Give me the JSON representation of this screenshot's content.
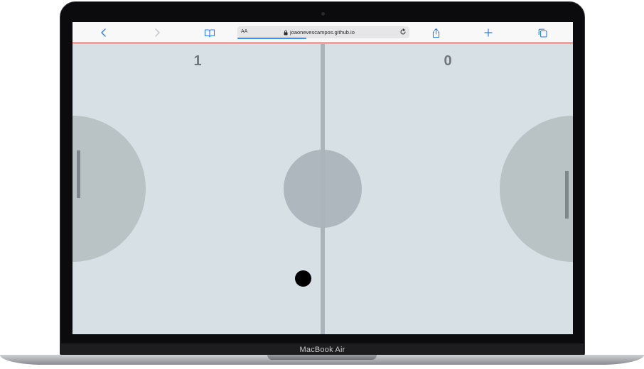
{
  "device": {
    "brand_label": "MacBook Air"
  },
  "browser": {
    "reader_label": "AA",
    "url": "joaonevescampos.github.io",
    "load_progress_percent": 40,
    "icons": {
      "back": "chevron-left-icon",
      "forward": "chevron-right-icon",
      "bookmarks": "book-icon",
      "lock": "lock-icon",
      "reload": "reload-icon",
      "share": "share-icon",
      "add": "plus-icon",
      "tabs": "tabs-icon"
    },
    "colors": {
      "accent": "#2d7cf6",
      "toolbar_border": "#c9352f"
    }
  },
  "game": {
    "score_left": "1",
    "score_right": "0",
    "colors": {
      "field": "#d6e0e5",
      "center_line": "#aab4ba",
      "paddle": "#7e878c",
      "ball": "#000000",
      "score_text": "#6f777c"
    }
  }
}
